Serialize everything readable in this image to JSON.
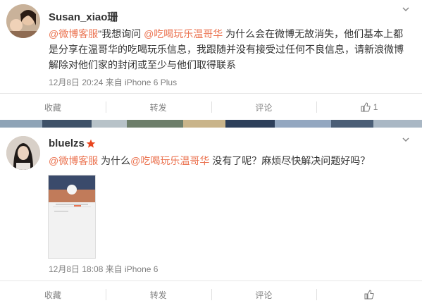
{
  "posts": [
    {
      "username": "Susan_xiao珊",
      "content": {
        "mention1": "@微博客服",
        "text1": "\"我想询问 ",
        "mention2": "@吃喝玩乐温哥华",
        "text2": " 为什么会在微博无故消失，他们基本上都是分享在温哥华的吃喝玩乐信息，我跟随并没有接受过任何不良信息，请新浪微博解除对他们家的封闭或至少与他们取得联系"
      },
      "meta": "12月8日 20:24 来自 iPhone 6 Plus",
      "actions": {
        "fav": "收藏",
        "repost": "转发",
        "comment": "评论",
        "like_count": "1"
      }
    },
    {
      "username": "bluelzs",
      "content": {
        "mention1": "@微博客服",
        "text1": " 为什么",
        "mention2": "@吃喝玩乐温哥华",
        "text2": " 没有了呢？麻烦尽快解决问题好吗？"
      },
      "meta": "12月8日 18:08 来自 iPhone 6",
      "actions": {
        "fav": "收藏",
        "repost": "转发",
        "comment": "评论"
      }
    }
  ],
  "colors": {
    "mention": "#eb7350",
    "badge_star": "#e8451e"
  },
  "icons": [
    "chevron-down-icon",
    "like-icon",
    "verified-star-icon"
  ]
}
